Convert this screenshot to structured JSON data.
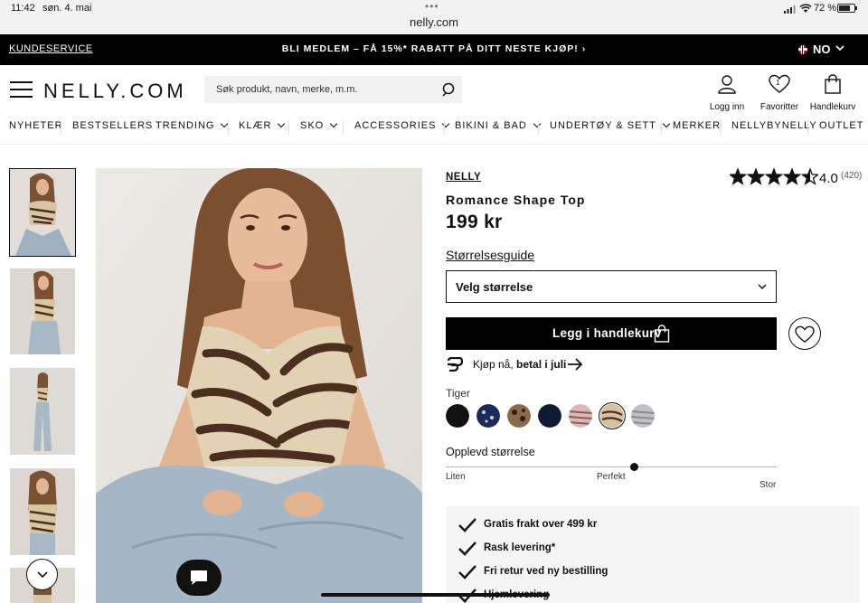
{
  "status_bar": {
    "time": "11:42",
    "date": "søn. 4. mai",
    "url": "nelly.com",
    "battery": "72 %"
  },
  "promo_bar": {
    "customer_service": "KUNDESERVICE",
    "promo_text": "BLI MEDLEM – FÅ 15%* RABATT PÅ DITT NESTE KJØP! ›",
    "language": "NO"
  },
  "header": {
    "logo": "NELLY.COM",
    "search_placeholder": "Søk produkt, navn, merke, m.m.",
    "login": "Logg inn",
    "favorites": "Favoritter",
    "favorites_count": "1",
    "cart": "Handlekurv"
  },
  "nav": [
    {
      "label": "NYHETER"
    },
    {
      "label": "BESTSELLERS"
    },
    {
      "label": "TRENDING"
    },
    {
      "label": "KLÆR"
    },
    {
      "label": "SKO"
    },
    {
      "label": "ACCESSORIES"
    },
    {
      "label": "BIKINI & BAD"
    },
    {
      "label": "UNDERTØY & SETT"
    },
    {
      "label": "MERKER"
    },
    {
      "label": "NELLYBYNELLY"
    },
    {
      "label": "OUTLET"
    }
  ],
  "product": {
    "brand": "NELLY",
    "name": "Romance Shape Top",
    "price": "199 kr",
    "rating": "4.0",
    "rating_value": 4.5,
    "review_count": "(420)",
    "size_guide": "Størrelsesguide",
    "size_select": "Velg størrelse",
    "add_to_cart": "Legg i handlekurv",
    "klarna_prefix": "Kjøp nå, ",
    "klarna_bold": "betal i juli",
    "color_label": "Tiger",
    "swatches": [
      {
        "name": "black",
        "color": "#111111"
      },
      {
        "name": "navy-print",
        "color": "#1c2b5a"
      },
      {
        "name": "leopard",
        "color": "#6b5137"
      },
      {
        "name": "dark-navy",
        "color": "#111a33"
      },
      {
        "name": "pink-stripe",
        "color": "#c9a6a3"
      },
      {
        "name": "tiger",
        "color": "#d7c19e",
        "selected": true
      },
      {
        "name": "grey-stripe",
        "color": "#a9a9ad"
      }
    ],
    "fit_title": "Opplevd størrelse",
    "fit_low": "Liten",
    "fit_mid": "Perfekt",
    "fit_high": "Stor",
    "fit_value": 0.57,
    "perks": [
      "Gratis frakt over 499 kr",
      "Rask levering*",
      "Fri retur ved ny bestilling",
      "Hjemlevering"
    ]
  },
  "colors": {
    "promo_bg": "#000000",
    "cart_button": "#000000",
    "search_bg": "#f1f1f1",
    "perks_bg": "#f5f5f5"
  }
}
